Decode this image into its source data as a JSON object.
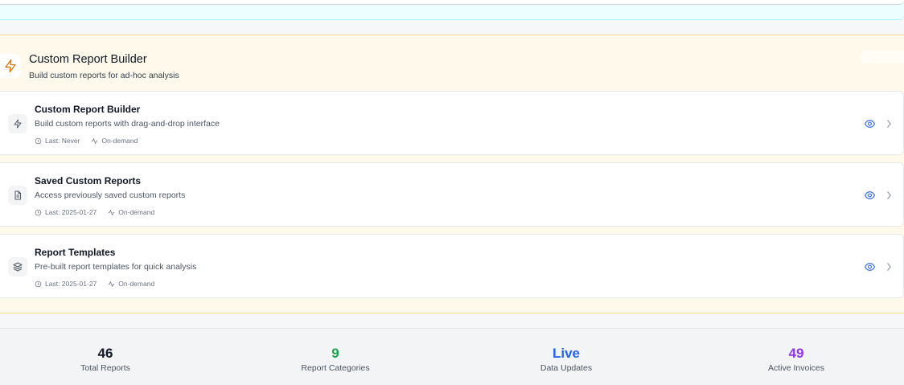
{
  "section": {
    "title": "Custom Report Builder",
    "subtitle": "Build custom reports for ad-hoc analysis",
    "icon": "lightning-icon",
    "accent": "#d97706"
  },
  "reports": [
    {
      "title": "Custom Report Builder",
      "description": "Build custom reports with drag-and-drop interface",
      "last": "Last: Never",
      "frequency": "On-demand",
      "icon": "lightning-icon"
    },
    {
      "title": "Saved Custom Reports",
      "description": "Access previously saved custom reports",
      "last": "Last: 2025-01-27",
      "frequency": "On-demand",
      "icon": "document-icon"
    },
    {
      "title": "Report Templates",
      "description": "Pre-built report templates for quick analysis",
      "last": "Last: 2025-01-27",
      "frequency": "On-demand",
      "icon": "layers-icon"
    }
  ],
  "stats": [
    {
      "value": "46",
      "label": "Total Reports",
      "color": "#111827"
    },
    {
      "value": "9",
      "label": "Report Categories",
      "color": "#16a34a"
    },
    {
      "value": "Live",
      "label": "Data Updates",
      "color": "#2563eb"
    },
    {
      "value": "49",
      "label": "Active Invoices",
      "color": "#9333ea"
    }
  ]
}
